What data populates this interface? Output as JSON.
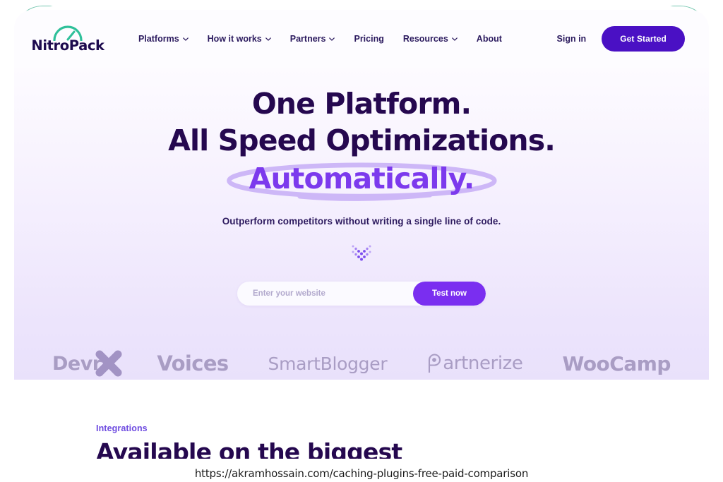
{
  "header": {
    "logo": {
      "word": "NitroPack",
      "icon": "speedometer-gauge-icon"
    },
    "nav": [
      {
        "label": "Platforms",
        "has_dropdown": true
      },
      {
        "label": "How it works",
        "has_dropdown": true
      },
      {
        "label": "Partners",
        "has_dropdown": true
      },
      {
        "label": "Pricing",
        "has_dropdown": false
      },
      {
        "label": "Resources",
        "has_dropdown": true
      },
      {
        "label": "About",
        "has_dropdown": false
      }
    ],
    "sign_in": "Sign in",
    "get_started": "Get Started"
  },
  "hero": {
    "headline_line1": "One Platform.",
    "headline_line2": "All Speed Optimizations.",
    "headline_highlight": "Automatically.",
    "subheadline": "Outperform competitors without writing a single line of code.",
    "scroll_icon": "double-chevron-down-dots-icon",
    "form": {
      "input_value": "",
      "input_placeholder": "Enter your website",
      "submit_label": "Test now"
    },
    "brands": [
      {
        "name": "DevriX",
        "text": "Devri"
      },
      {
        "name": "Voices",
        "text": "Voices"
      },
      {
        "name": "SmartBlogger",
        "text": "SmartBlogger"
      },
      {
        "name": "Partnerize",
        "text": "artnerize"
      },
      {
        "name": "WooCamp",
        "text": "WooCamp"
      }
    ]
  },
  "integrations": {
    "eyebrow": "Integrations",
    "title": "Available on the biggest"
  },
  "caption": {
    "url": "https://akramhossain.com/caching-plugins-free-paid-comparison"
  },
  "colors": {
    "brand_purple": "#4a10c4",
    "accent_purple": "#7c3aed",
    "headline_navy": "#25084f",
    "logo_teal": "#2fc09a",
    "frame_teal": "#5dbda2",
    "hero_gradient_top": "#fdfbff",
    "hero_gradient_bottom": "#e9e1fb",
    "brand_grey": "#a99dc4"
  }
}
